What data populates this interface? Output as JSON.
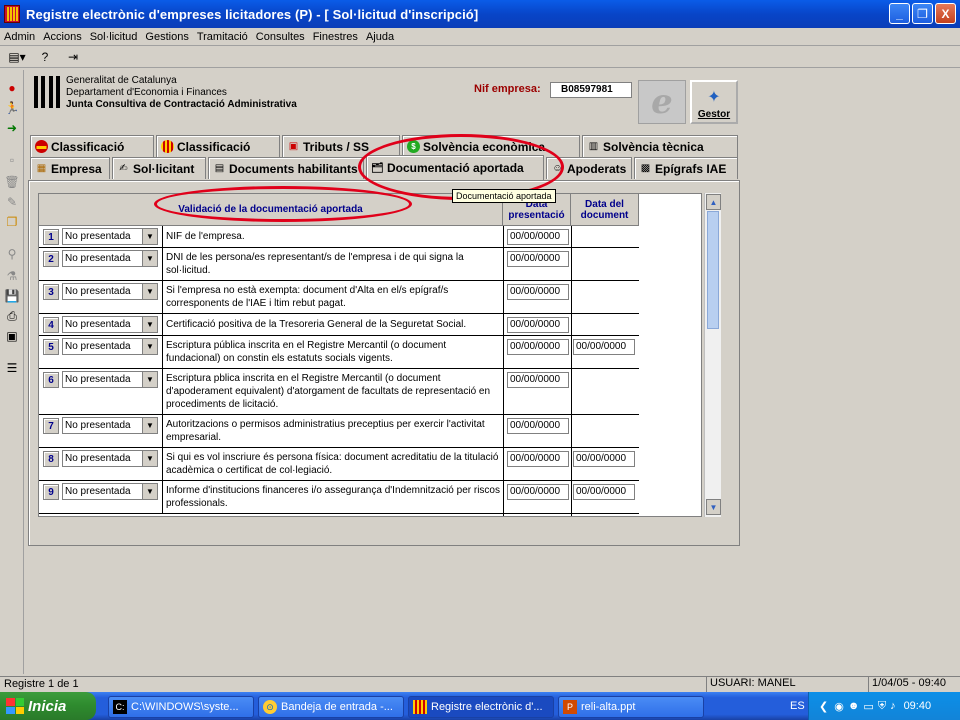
{
  "window": {
    "title": "Registre electrònic d'empreses licitadores (P) - [ Sol·licitud d'inscripció]",
    "buttons": {
      "minimize": "_",
      "maximize": "❐",
      "close": "X"
    }
  },
  "menu": [
    "Admin",
    "Accions",
    "Sol·licitud",
    "Gestions",
    "Tramitació",
    "Consultes",
    "Finestres",
    "Ajuda"
  ],
  "header": {
    "org_line1": "Generalitat de Catalunya",
    "org_line2": "Departament d'Economia i Finances",
    "org_line3": "Junta Consultiva de Contractació Administrativa",
    "nif_label": "Nif empresa:",
    "nif_value": "B08597981",
    "e_label": "e",
    "gestor_label": "Gestor"
  },
  "tabs_row1": [
    {
      "label": "Classificació"
    },
    {
      "label": "Classificació"
    },
    {
      "label": "Tributs / SS"
    },
    {
      "label": "Solvència econòmica"
    },
    {
      "label": "Solvència tècnica"
    }
  ],
  "tabs_row2": [
    {
      "label": "Empresa"
    },
    {
      "label": "Sol·licitant"
    },
    {
      "label": "Documents habilitants"
    },
    {
      "label": "Documentació aportada"
    },
    {
      "label": "Apoderats"
    },
    {
      "label": "Epígrafs IAE"
    }
  ],
  "tooltip": "Documentació aportada",
  "grid": {
    "header_validacio": "Validació de la documentació aportada",
    "header_data_presentacio": "Data presentació",
    "header_data_document": "Data del document",
    "rows": [
      {
        "num": "1",
        "status": "No presentada",
        "desc": "NIF de l'empresa.",
        "date_pres": "00/00/0000",
        "date_doc": ""
      },
      {
        "num": "2",
        "status": "No presentada",
        "desc": "DNI de les persona/es representant/s de l'empresa i de qui signa la sol·licitud.",
        "date_pres": "00/00/0000",
        "date_doc": ""
      },
      {
        "num": "3",
        "status": "No presentada",
        "desc": "Si l'empresa no està exempta: document d'Alta en el/s epígraf/s corresponents de l'IAE i ltim rebut pagat.",
        "date_pres": "00/00/0000",
        "date_doc": ""
      },
      {
        "num": "4",
        "status": "No presentada",
        "desc": "Certificació positiva de la Tresoreria General de la Seguretat Social.",
        "date_pres": "00/00/0000",
        "date_doc": ""
      },
      {
        "num": "5",
        "status": "No presentada",
        "desc": "Escriptura pública inscrita en el Registre Mercantil (o document fundacional) on constin els estatuts socials vigents.",
        "date_pres": "00/00/0000",
        "date_doc": "00/00/0000"
      },
      {
        "num": "6",
        "status": "No presentada",
        "desc": "Escriptura pblica inscrita en el Registre Mercantil (o document d'apoderament equivalent) d'atorgament de facultats de representació en procediments de licitació.",
        "date_pres": "00/00/0000",
        "date_doc": ""
      },
      {
        "num": "7",
        "status": "No presentada",
        "desc": "Autoritzacions o permisos administratius preceptius per exercir l'activitat empresarial.",
        "date_pres": "00/00/0000",
        "date_doc": ""
      },
      {
        "num": "8",
        "status": "No presentada",
        "desc": "Si qui es vol inscriure és persona física: document acreditatiu de la titulació acadèmica o certificat de col·legiació.",
        "date_pres": "00/00/0000",
        "date_doc": "00/00/0000"
      },
      {
        "num": "9",
        "status": "No presentada",
        "desc": "Informe d'institucions financeres i/o assegurança d'Indemnització per riscos professionals.",
        "date_pres": "00/00/0000",
        "date_doc": "00/00/0000"
      }
    ]
  },
  "status": {
    "record": "Registre 1 de 1",
    "user": "USUARI: MANEL",
    "datetime": "1/04/05 - 09:40"
  },
  "taskbar": {
    "start": "Inicia",
    "tasks": [
      "C:\\WINDOWS\\syste...",
      "Bandeja de entrada -...",
      "Registre electrònic d'...",
      "reli-alta.ppt"
    ],
    "lang": "ES",
    "clock": "09:40"
  },
  "colors": {
    "accent_red": "#e0001a",
    "nif_label": "#9b0000",
    "header_blue": "#00008b"
  }
}
